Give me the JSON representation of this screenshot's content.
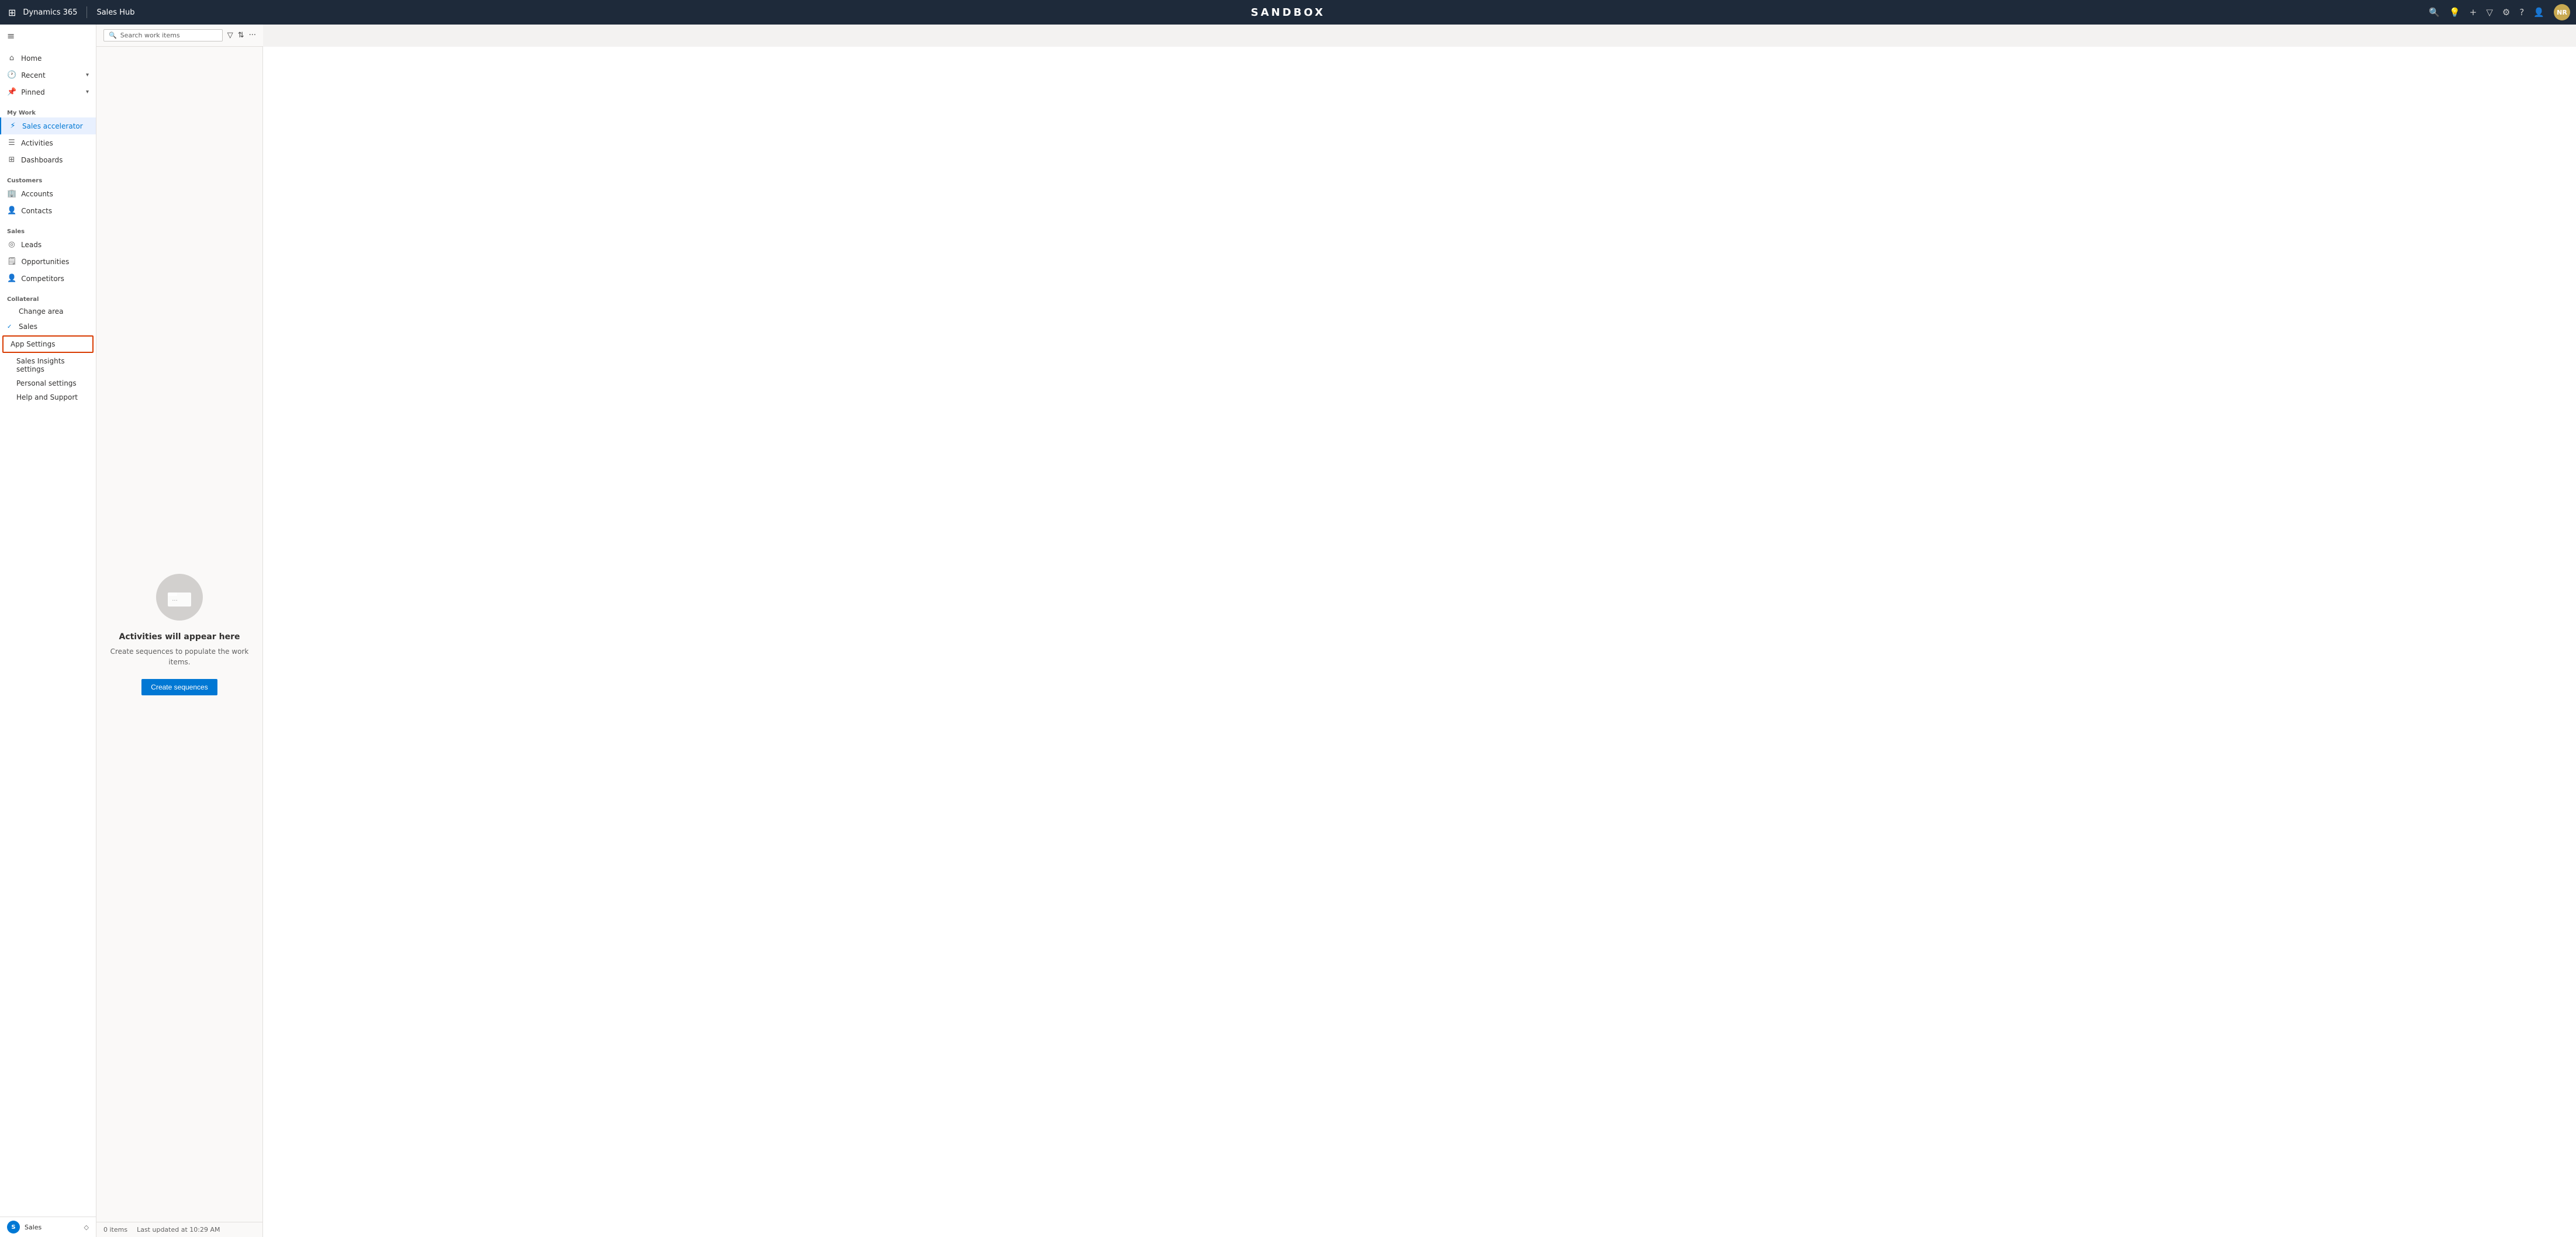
{
  "topnav": {
    "waffle_label": "⊞",
    "d365_label": "Dynamics 365",
    "divider": "|",
    "app_name": "Sales Hub",
    "sandbox_label": "SANDBOX",
    "search_icon": "🔍",
    "lightbulb_icon": "💡",
    "plus_icon": "+",
    "filter_icon": "▽",
    "settings_icon": "⚙",
    "help_icon": "?",
    "user_icon": "👤",
    "avatar_label": "NR"
  },
  "sidebar": {
    "toggle_icon": "≡",
    "items": [
      {
        "id": "home",
        "icon": "⌂",
        "label": "Home",
        "active": false
      },
      {
        "id": "recent",
        "icon": "🕐",
        "label": "Recent",
        "chevron": "▾",
        "active": false
      },
      {
        "id": "pinned",
        "icon": "📌",
        "label": "Pinned",
        "chevron": "▾",
        "active": false
      }
    ],
    "my_work_section": "My Work",
    "my_work_items": [
      {
        "id": "sales-accelerator",
        "icon": "⚡",
        "label": "Sales accelerator",
        "active": true
      },
      {
        "id": "activities",
        "icon": "☰",
        "label": "Activities",
        "active": false
      },
      {
        "id": "dashboards",
        "icon": "⊞",
        "label": "Dashboards",
        "active": false
      }
    ],
    "customers_section": "Customers",
    "customers_items": [
      {
        "id": "accounts",
        "icon": "🏢",
        "label": "Accounts",
        "active": false
      },
      {
        "id": "contacts",
        "icon": "👤",
        "label": "Contacts",
        "active": false
      }
    ],
    "sales_section": "Sales",
    "sales_items": [
      {
        "id": "leads",
        "icon": "◎",
        "label": "Leads",
        "active": false
      },
      {
        "id": "opportunities",
        "icon": "🗒",
        "label": "Opportunities",
        "active": false
      },
      {
        "id": "competitors",
        "icon": "👤",
        "label": "Competitors",
        "active": false
      }
    ],
    "collateral_section": "Collateral",
    "change_area_label": "Change area",
    "sales_check": "Sales",
    "app_settings_label": "App Settings",
    "sub_items": [
      {
        "id": "sales-insights-settings",
        "label": "Sales Insights settings"
      },
      {
        "id": "personal-settings",
        "label": "Personal settings"
      },
      {
        "id": "help-and-support",
        "label": "Help and Support"
      }
    ]
  },
  "sidebar_bottom": {
    "avatar_label": "S",
    "text": "Sales",
    "icon": "◇"
  },
  "work_items_header": {
    "search_placeholder": "Search work items",
    "filter_icon": "▽",
    "sort_icon": "⇅",
    "more_icon": "···"
  },
  "empty_state": {
    "icon": "▤",
    "title": "Activities will appear here",
    "description": "Create sequences to populate the work items.",
    "button_label": "Create sequences"
  },
  "footer": {
    "items_count": "0 items",
    "last_updated": "Last updated at 10:29 AM"
  }
}
